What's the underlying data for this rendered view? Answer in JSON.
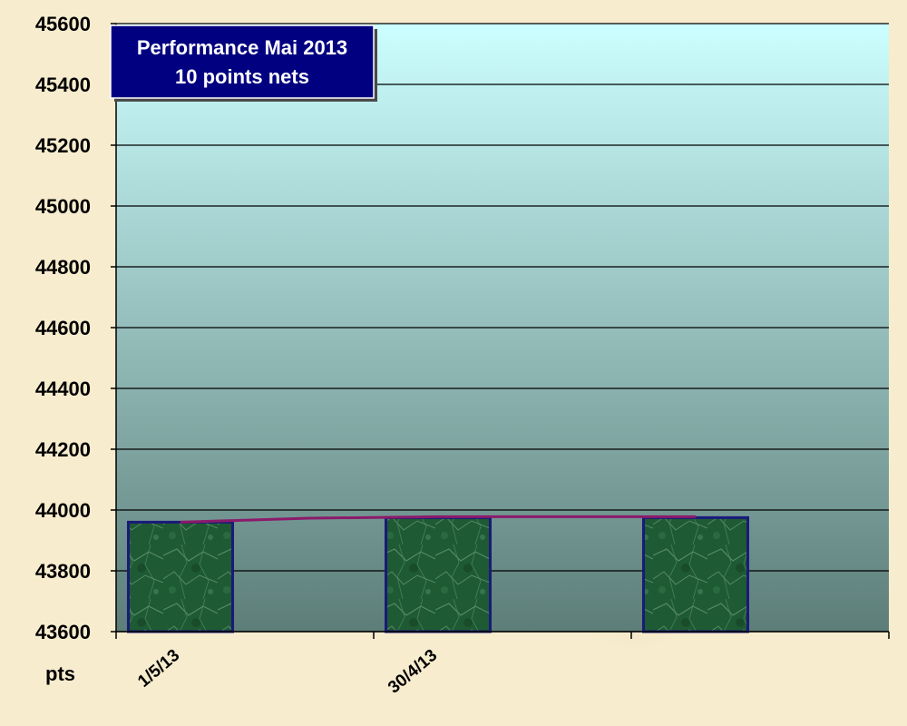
{
  "chart_data": {
    "type": "bar",
    "title": "Performance  Mai  2013",
    "subtitle": "10  points nets",
    "unit_label": "pts",
    "ylim": [
      43600,
      45600
    ],
    "ytick_step": 200,
    "categories": [
      "1/5/13",
      "",
      "30/4/13",
      "",
      "",
      ""
    ],
    "bar_values": [
      43960,
      43975,
      43975
    ],
    "line_values": [
      43960,
      43973,
      43978,
      43978,
      43978
    ],
    "grid": true,
    "legend": "none",
    "colors": {
      "plot_top": "#ccffff",
      "plot_bottom": "#5d7d78",
      "bar_fill": "#1e5a34",
      "bar_border": "#1a1a7a",
      "line": "#8b1a6b",
      "title_box": "#000080",
      "gridline": "#000000"
    }
  }
}
